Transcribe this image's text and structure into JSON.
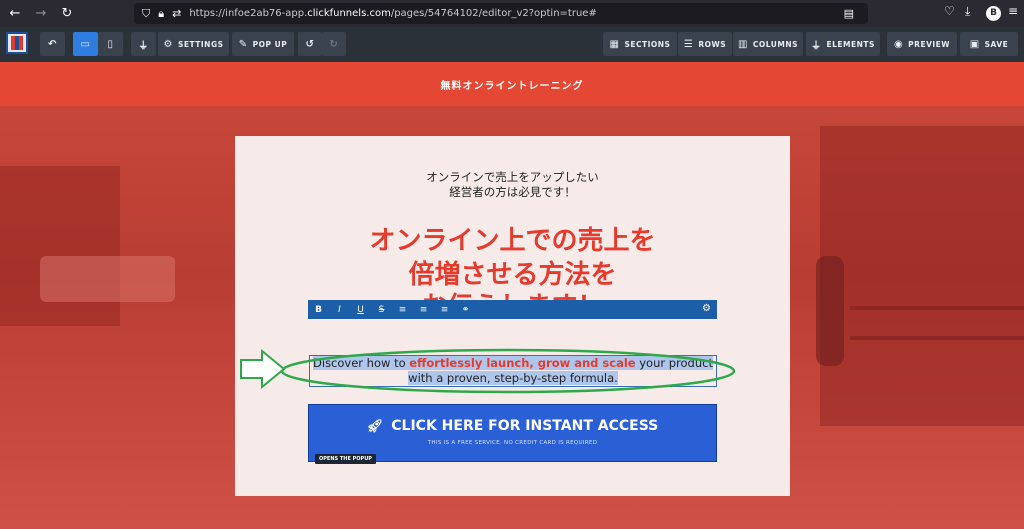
{
  "browser": {
    "url_prefix": "https://infoe2ab76-app.",
    "url_domain": "clickfunnels.com",
    "url_path": "/pages/54764102/editor_v2?optin=true#",
    "avatar_letter": "B"
  },
  "toolbar": {
    "settings": "SETTINGS",
    "popup": "POP UP",
    "sections": "SECTIONS",
    "rows": "ROWS",
    "columns": "COLUMNS",
    "elements": "ELEMENTS",
    "preview": "PREVIEW",
    "save": "SAVE"
  },
  "page": {
    "header_text": "無料オンライントレーニング",
    "sub_line1": "オンラインで売上をアップしたい",
    "sub_line2": "経営者の方は必見です！",
    "headline_line1": "オンライン上での売上を",
    "headline_line2": "倍増させる方法を",
    "headline_line3": "お伝えします！",
    "desc_pre": "Discover how to ",
    "desc_highlight": "effortlessly launch, grow and scale",
    "desc_post_1": " your product",
    "desc_line2": "with a proven, step-by-step formula.",
    "cta_label": "CLICK HERE FOR INSTANT ACCESS",
    "cta_sub": "THIS IS A FREE SERVICE. NO CREDIT CARD IS REQUIRED",
    "popup_tag": "OPENS THE POPUP"
  },
  "colors": {
    "accent_red": "#e53a2c",
    "cta_blue": "#2a5fd6",
    "annotation_green": "#2fa84a",
    "toolbar_active": "#2f7de1"
  }
}
